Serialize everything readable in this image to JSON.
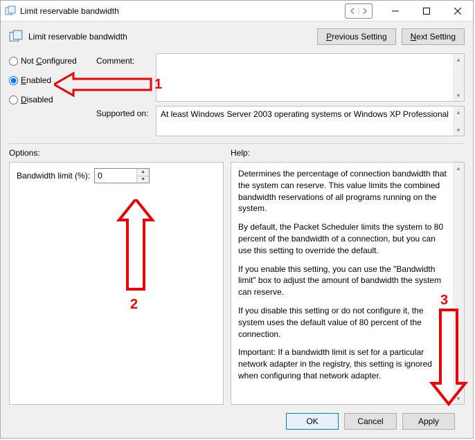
{
  "window": {
    "title": "Limit reservable bandwidth"
  },
  "header": {
    "title": "Limit reservable bandwidth",
    "prev_btn": "Previous Setting",
    "prev_u": "P",
    "next_btn": "Next Setting",
    "next_u": "N"
  },
  "radios": {
    "not_configured": "Not Configured",
    "not_configured_u": "C",
    "enabled": "Enabled",
    "enabled_u": "E",
    "disabled": "Disabled",
    "disabled_u": "D",
    "selected": "enabled"
  },
  "labels": {
    "comment": "Comment:",
    "supported_on": "Supported on:",
    "options": "Options:",
    "help": "Help:"
  },
  "supported_text": "At least Windows Server 2003 operating systems or Windows XP Professional",
  "options": {
    "bandwidth_label": "Bandwidth limit (%):",
    "bandwidth_value": "0"
  },
  "help": {
    "p1": "Determines the percentage of connection bandwidth that the system can reserve. This value limits the combined bandwidth reservations of all programs running on the system.",
    "p2": "By default, the Packet Scheduler limits the system to 80 percent of the bandwidth of a connection, but you can use this setting to override the default.",
    "p3": "If you enable this setting, you can use the \"Bandwidth limit\" box to adjust the amount of bandwidth the system can reserve.",
    "p4": "If you disable this setting or do not configure it, the system uses the default value of 80 percent of the connection.",
    "p5": "Important: If a bandwidth limit is set for a particular network adapter in the registry, this setting is ignored when configuring that network adapter."
  },
  "footer": {
    "ok": "OK",
    "cancel": "Cancel",
    "apply": "Apply",
    "apply_u": "A"
  },
  "annotations": {
    "a1": "1",
    "a2": "2",
    "a3": "3"
  }
}
